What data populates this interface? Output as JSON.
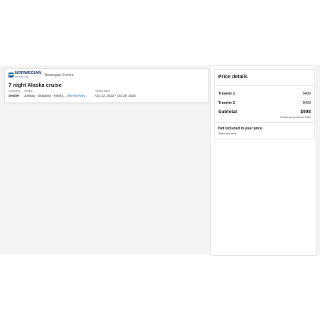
{
  "cruise_card": {
    "logo_main": "NORWEGIAN",
    "logo_sub": "CRUISE LINE",
    "ship_name": "Norwegian Encore",
    "title": "7 night Alaska cruise",
    "departing_label": "Departing",
    "departing_value": "Seattle",
    "visiting_label": "Visiting",
    "visiting_value": "Juneau · Skagway · Ketchi...",
    "itinerary_link": "See itinerary",
    "sailing_label": "Sailing dates",
    "sailing_value": "Oct 22, 2023 - Oct 29, 2023"
  },
  "price_details": {
    "title": "Price details",
    "travelers": [
      {
        "label": "Traveler 1",
        "amount": "$499"
      },
      {
        "label": "Traveler 2",
        "amount": "$499"
      }
    ],
    "subtotal_label": "Subtotal",
    "subtotal_amount": "$998",
    "quoted_note": "Prices are quoted in USD",
    "not_included_title": "Not included in your price",
    "not_included_items": "Taxes and fees"
  },
  "colors": {
    "brand": "#0d2d5e",
    "link": "#1f5fa8",
    "background_band": "#f3f3f3"
  }
}
